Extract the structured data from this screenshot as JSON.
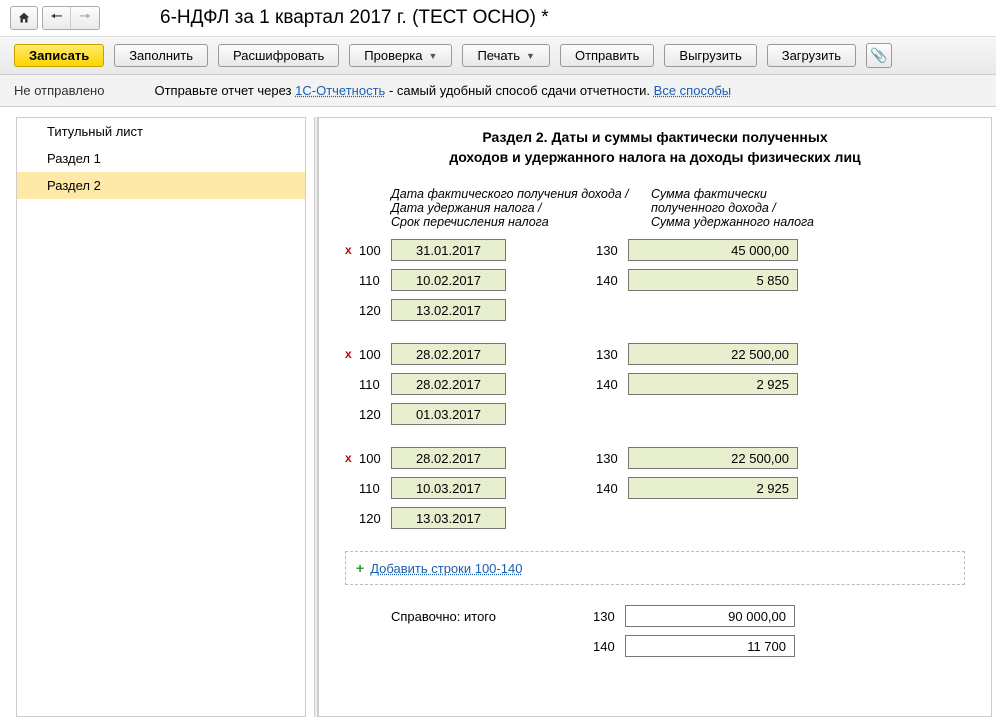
{
  "title": "6-НДФЛ за 1 квартал 2017 г. (ТЕСТ ОСНО) *",
  "toolbar": {
    "save": "Записать",
    "fill": "Заполнить",
    "decode": "Расшифровать",
    "check": "Проверка",
    "print": "Печать",
    "send": "Отправить",
    "export": "Выгрузить",
    "import": "Загрузить"
  },
  "status": {
    "left": "Не отправлено",
    "prefix": "Отправьте отчет через ",
    "link1": "1С-Отчетность",
    "suffix": " - самый удобный способ сдачи отчетности. ",
    "link2": "Все способы"
  },
  "sidebar": {
    "items": [
      {
        "label": "Титульный лист"
      },
      {
        "label": "Раздел 1"
      },
      {
        "label": "Раздел 2"
      }
    ]
  },
  "section": {
    "title1": "Раздел 2.  Даты и суммы фактически полученных",
    "title2": "доходов и удержанного налога на доходы физических лиц",
    "headLeft": "Дата фактического получения дохода / Дата удержания налога /\nСрок перечисления налога",
    "headRight": "Сумма фактически полученного дохода /\nСумма удержанного налога"
  },
  "blocks": [
    {
      "rows": [
        {
          "x": true,
          "c1": "100",
          "v1": "31.01.2017",
          "c2": "130",
          "v2": "45 000,00"
        },
        {
          "x": false,
          "c1": "110",
          "v1": "10.02.2017",
          "c2": "140",
          "v2": "5 850"
        },
        {
          "x": false,
          "c1": "120",
          "v1": "13.02.2017"
        }
      ]
    },
    {
      "rows": [
        {
          "x": true,
          "c1": "100",
          "v1": "28.02.2017",
          "c2": "130",
          "v2": "22 500,00"
        },
        {
          "x": false,
          "c1": "110",
          "v1": "28.02.2017",
          "c2": "140",
          "v2": "2 925"
        },
        {
          "x": false,
          "c1": "120",
          "v1": "01.03.2017"
        }
      ]
    },
    {
      "rows": [
        {
          "x": true,
          "c1": "100",
          "v1": "28.02.2017",
          "c2": "130",
          "v2": "22 500,00"
        },
        {
          "x": false,
          "c1": "110",
          "v1": "10.03.2017",
          "c2": "140",
          "v2": "2 925"
        },
        {
          "x": false,
          "c1": "120",
          "v1": "13.03.2017"
        }
      ]
    }
  ],
  "addRowsLabel": "Добавить строки 100-140",
  "totals": {
    "label": "Справочно: итого",
    "r130c": "130",
    "r130v": "90 000,00",
    "r140c": "140",
    "r140v": "11 700"
  }
}
